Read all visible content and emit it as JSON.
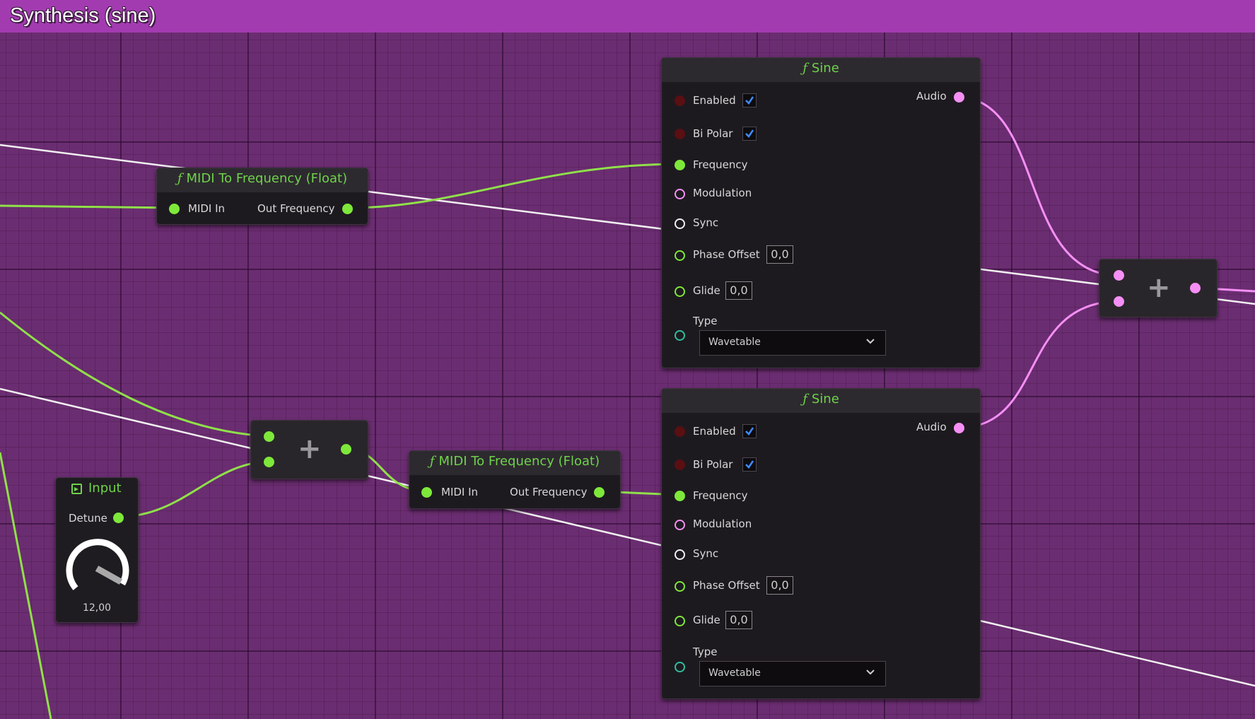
{
  "title": "Synthesis (sine)",
  "colors": {
    "float_pin": "#7ee83a",
    "audio_pin": "#f58ff5",
    "exec_wire": "#f0f0f0",
    "title_bar": "#a23bb0",
    "node_title_text": "#6fd24a"
  },
  "nodes": {
    "midi1": {
      "title": "MIDI To Frequency (Float)",
      "input": "MIDI In",
      "output": "Out Frequency"
    },
    "midi2": {
      "title": "MIDI To Frequency (Float)",
      "input": "MIDI In",
      "output": "Out Frequency"
    },
    "add1": {
      "symbol": "+"
    },
    "add2": {
      "symbol": "+"
    },
    "input": {
      "title": "Input",
      "pin": "Detune",
      "knob_value": "12,00"
    },
    "sine1": {
      "title": "Sine",
      "enabled_label": "Enabled",
      "enabled": true,
      "bipolar_label": "Bi Polar",
      "bipolar": true,
      "frequency_label": "Frequency",
      "modulation_label": "Modulation",
      "sync_label": "Sync",
      "phase_offset_label": "Phase Offset",
      "phase_offset": "0,0",
      "glide_label": "Glide",
      "glide": "0,0",
      "type_label": "Type",
      "type_value": "Wavetable",
      "output": "Audio"
    },
    "sine2": {
      "title": "Sine",
      "enabled_label": "Enabled",
      "enabled": true,
      "bipolar_label": "Bi Polar",
      "bipolar": true,
      "frequency_label": "Frequency",
      "modulation_label": "Modulation",
      "sync_label": "Sync",
      "phase_offset_label": "Phase Offset",
      "phase_offset": "0,0",
      "glide_label": "Glide",
      "glide": "0,0",
      "type_label": "Type",
      "type_value": "Wavetable",
      "output": "Audio"
    }
  }
}
